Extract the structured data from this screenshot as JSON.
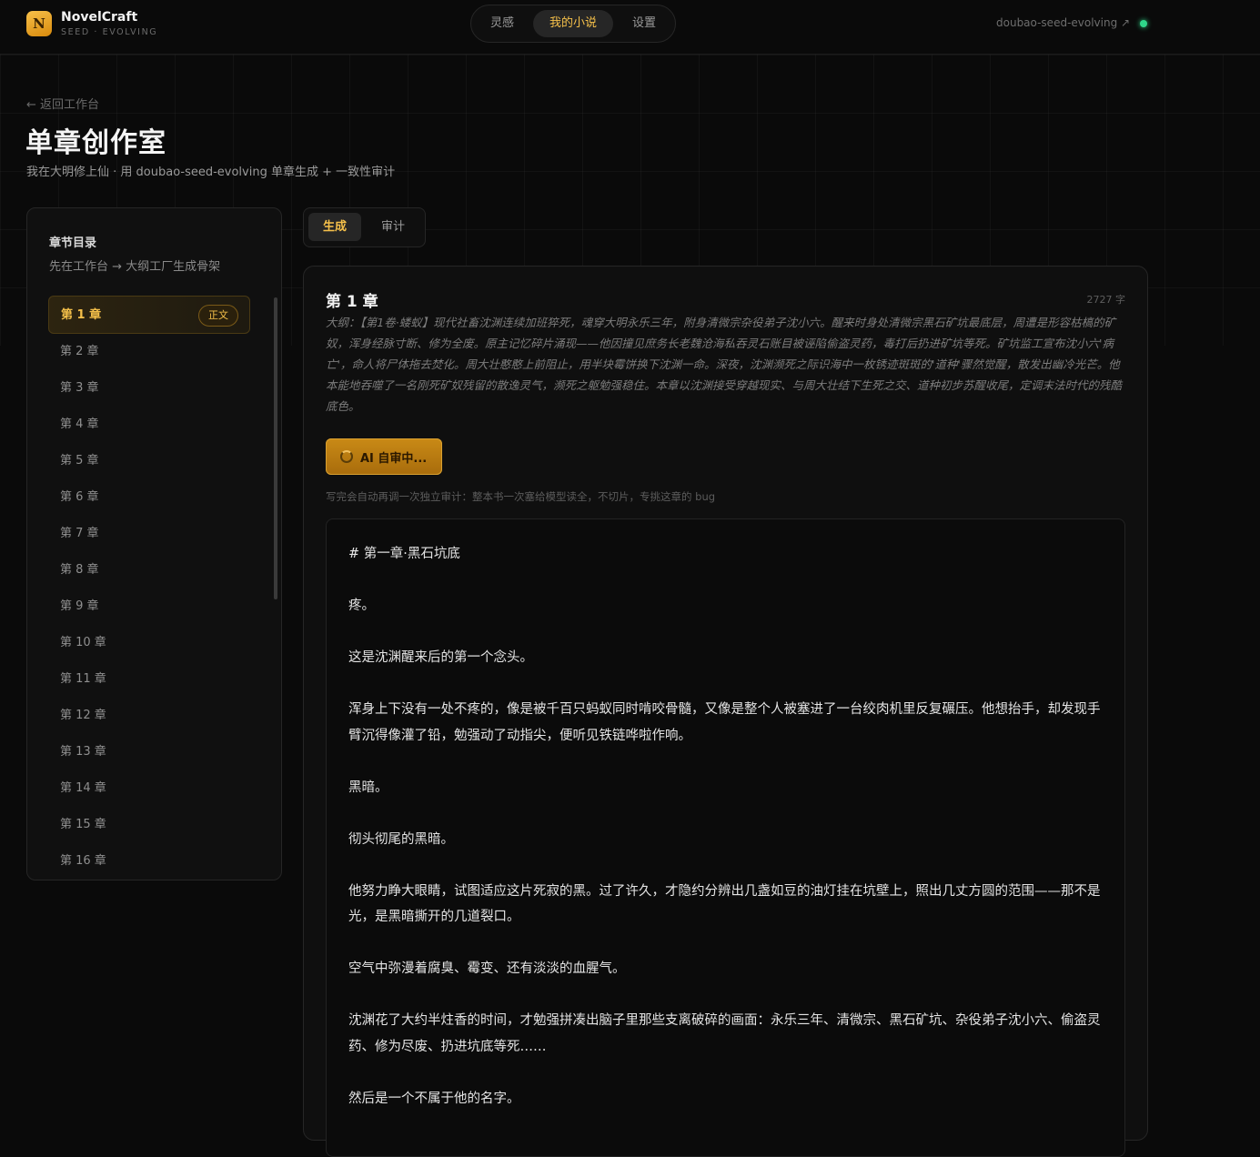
{
  "app": {
    "logo_letter": "N",
    "name": "NovelCraft",
    "subtitle": "SEED · EVOLVING"
  },
  "nav": {
    "items": [
      {
        "label": "灵感",
        "active": false
      },
      {
        "label": "我的小说",
        "active": true
      },
      {
        "label": "设置",
        "active": false
      }
    ]
  },
  "header_right": {
    "model_link": "doubao-seed-evolving ↗",
    "status": "online",
    "status_color": "#2fd68a"
  },
  "page": {
    "back_link": "← 返回工作台",
    "title": "单章创作室",
    "subtitle": "我在大明修上仙 · 用 doubao-seed-evolving 单章生成 + 一致性审计"
  },
  "sidebar": {
    "title": "章节目录",
    "description": "先在工作台 → 大纲工厂生成骨架",
    "active_badge": "正文",
    "chapters": [
      "第 1 章",
      "第 2 章",
      "第 3 章",
      "第 4 章",
      "第 5 章",
      "第 6 章",
      "第 7 章",
      "第 8 章",
      "第 9 章",
      "第 10 章",
      "第 11 章",
      "第 12 章",
      "第 13 章",
      "第 14 章",
      "第 15 章",
      "第 16 章"
    ]
  },
  "tabs": {
    "generate": "生成",
    "audit": "审计"
  },
  "chapter": {
    "title": "第 1 章",
    "word_count": "2727 字",
    "outline": "大纲：【第1卷·蝼蚁】现代社畜沈渊连续加班猝死，魂穿大明永乐三年，附身清微宗杂役弟子沈小六。醒来时身处清微宗黑石矿坑最底层，周遭是形容枯槁的矿奴，浑身经脉寸断、修为全废。原主记忆碎片涌现——他因撞见庶务长老魏沧海私吞灵石账目被诬陷偷盗灵药，毒打后扔进矿坑等死。矿坑监工宣布沈小六'病亡'，命人将尸体拖去焚化。周大壮憨憨上前阻止，用半块霉饼换下沈渊一命。深夜，沈渊濒死之际识海中一枚锈迹斑斑的'道种'骤然觉醒，散发出幽冷光芒。他本能地吞噬了一名刚死矿奴残留的散逸灵气，濒死之躯勉强稳住。本章以沈渊接受穿越现实、与周大壮结下生死之交、道种初步苏醒收尾，定调末法时代的残酷底色。",
    "audit_button": "AI 自审中...",
    "audit_note": "写完会自动再调一次独立审计：整本书一次塞给模型读全，不切片，专挑这章的 bug",
    "paragraphs": [
      "# 第一章·黑石坑底",
      "疼。",
      "这是沈渊醒来后的第一个念头。",
      "浑身上下没有一处不疼的，像是被千百只蚂蚁同时啃咬骨髓，又像是整个人被塞进了一台绞肉机里反复碾压。他想抬手，却发现手臂沉得像灌了铅，勉强动了动指尖，便听见铁链哗啦作响。",
      "黑暗。",
      "彻头彻尾的黑暗。",
      "他努力睁大眼睛，试图适应这片死寂的黑。过了许久，才隐约分辨出几盏如豆的油灯挂在坑壁上，照出几丈方圆的范围——那不是光，是黑暗撕开的几道裂口。",
      "空气中弥漫着腐臭、霉变、还有淡淡的血腥气。",
      "沈渊花了大约半炷香的时间，才勉强拼凑出脑子里那些支离破碎的画面：永乐三年、清微宗、黑石矿坑、杂役弟子沈小六、偷盗灵药、修为尽废、扔进坑底等死……",
      "然后是一个不属于他的名字。"
    ]
  }
}
